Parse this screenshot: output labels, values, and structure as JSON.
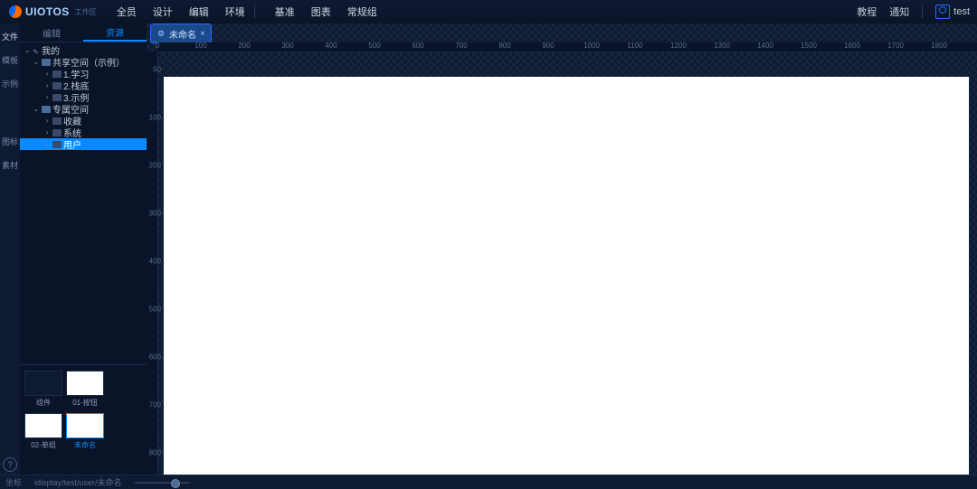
{
  "app": {
    "name": "UIOTOS",
    "tagline": "工作区"
  },
  "menu": [
    "全员",
    "设计",
    "编辑",
    "环境"
  ],
  "menu2": [
    "基准",
    "图表",
    "常规组"
  ],
  "right_menu": [
    "教程",
    "通知"
  ],
  "user": "test",
  "rail": [
    "文件",
    "模板",
    "示例",
    "help",
    "图标",
    "素材"
  ],
  "panel_tabs": {
    "editor": "编辑",
    "assets": "资源"
  },
  "tree": {
    "root": "我的",
    "shared_space": "共享空间（示例）",
    "shared_children": [
      "1.学习",
      "2.栈底",
      "3.示例"
    ],
    "user_space": "专属空间",
    "user_children": [
      "收藏",
      "系统",
      "用户"
    ]
  },
  "thumbs": [
    {
      "label": "组件",
      "dark": true
    },
    {
      "label": "01-按钮",
      "dark": false
    },
    {
      "label": "02-单组",
      "dark": false
    },
    {
      "label": "未命名",
      "dark": false,
      "selected": true
    }
  ],
  "document_tab": {
    "icon": "⚙",
    "label": "未命名",
    "close": "×"
  },
  "ruler_h": [
    0,
    100,
    200,
    300,
    400,
    500,
    600,
    700,
    800,
    900,
    1000,
    1100,
    1200,
    1300,
    1400,
    1500,
    1600,
    1700,
    1800
  ],
  "ruler_v": [
    50,
    100,
    200,
    300,
    400,
    500,
    600,
    700,
    800
  ],
  "status": {
    "coords": "坐标",
    "path": "idisplay/test/user/未命名",
    "zoom": ""
  }
}
